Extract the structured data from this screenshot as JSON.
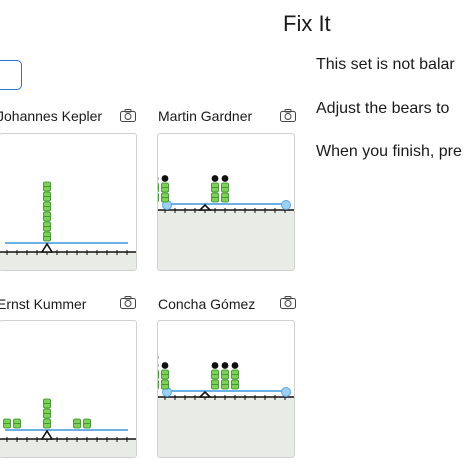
{
  "page": {
    "title": "Fix It"
  },
  "instructions": [
    "This set is not balar",
    "Adjust the bears to",
    "When you finish, pre"
  ],
  "colors": {
    "bear_green": "#7ed05a",
    "bear_dark": "#2f8a1f",
    "beam_blue": "#56a6e4",
    "ground": "#e9ebe6",
    "accent": "#2f6fd6"
  },
  "students": [
    {
      "name": "Johannes Kepler",
      "balanced": true,
      "stacks": [
        {
          "pos": 0,
          "bears": 6,
          "black": 0
        }
      ]
    },
    {
      "name": "Martin Gardner",
      "balanced": false,
      "stacks": [
        {
          "pos": -5,
          "bears": 2,
          "black": 1
        },
        {
          "pos": -4,
          "bears": 2,
          "black": 1
        },
        {
          "pos": 1,
          "bears": 2,
          "black": 1
        },
        {
          "pos": 2,
          "bears": 2,
          "black": 1
        }
      ]
    },
    {
      "name": "Ernst Kummer",
      "balanced": true,
      "stacks": [
        {
          "pos": -4,
          "bears": 1,
          "black": 0
        },
        {
          "pos": -3,
          "bears": 1,
          "black": 0
        },
        {
          "pos": 0,
          "bears": 3,
          "black": 0
        },
        {
          "pos": 3,
          "bears": 1,
          "black": 0
        },
        {
          "pos": 4,
          "bears": 1,
          "black": 0
        }
      ]
    },
    {
      "name": "Concha Gómez",
      "balanced": false,
      "stacks": [
        {
          "pos": -5,
          "bears": 2,
          "black": 2
        },
        {
          "pos": -4,
          "bears": 2,
          "black": 1
        },
        {
          "pos": 1,
          "bears": 2,
          "black": 1
        },
        {
          "pos": 2,
          "bears": 2,
          "black": 1
        },
        {
          "pos": 3,
          "bears": 2,
          "black": 1
        }
      ]
    }
  ]
}
